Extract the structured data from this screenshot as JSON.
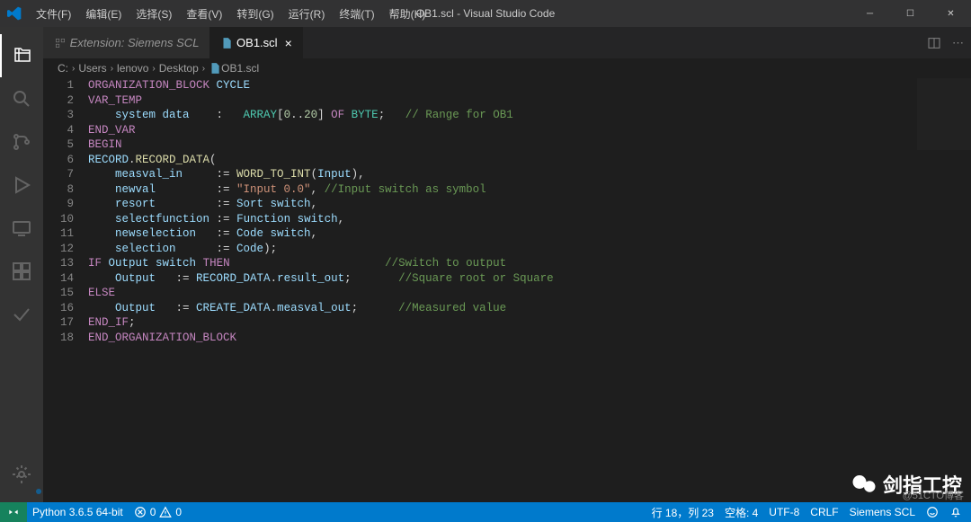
{
  "window": {
    "title": "OB1.scl - Visual Studio Code"
  },
  "menu": {
    "file": "文件(F)",
    "edit": "编辑(E)",
    "select": "选择(S)",
    "view": "查看(V)",
    "go": "转到(G)",
    "run": "运行(R)",
    "terminal": "终端(T)",
    "help": "帮助(H)"
  },
  "tabs": {
    "ext": "Extension: Siemens SCL",
    "file": "OB1.scl"
  },
  "breadcrumb": {
    "seg0": "C:",
    "seg1": "Users",
    "seg2": "lenovo",
    "seg3": "Desktop",
    "seg4": "OB1.scl"
  },
  "lines": [
    [
      {
        "t": "k",
        "v": "ORGANIZATION_BLOCK"
      },
      {
        "t": "p",
        "v": " "
      },
      {
        "t": "id",
        "v": "CYCLE"
      }
    ],
    [
      {
        "t": "k",
        "v": "VAR_TEMP"
      }
    ],
    [
      {
        "t": "p",
        "v": "    "
      },
      {
        "t": "id",
        "v": "system data"
      },
      {
        "t": "p",
        "v": "    :   "
      },
      {
        "t": "ty",
        "v": "ARRAY"
      },
      {
        "t": "p",
        "v": "["
      },
      {
        "t": "n",
        "v": "0"
      },
      {
        "t": "p",
        "v": ".."
      },
      {
        "t": "n",
        "v": "20"
      },
      {
        "t": "p",
        "v": "] "
      },
      {
        "t": "k",
        "v": "OF"
      },
      {
        "t": "p",
        "v": " "
      },
      {
        "t": "ty",
        "v": "BYTE"
      },
      {
        "t": "p",
        "v": ";   "
      },
      {
        "t": "c",
        "v": "// Range for OB1"
      }
    ],
    [
      {
        "t": "k",
        "v": "END_VAR"
      }
    ],
    [
      {
        "t": "k",
        "v": "BEGIN"
      }
    ],
    [
      {
        "t": "id",
        "v": "RECORD"
      },
      {
        "t": "p",
        "v": "."
      },
      {
        "t": "fn",
        "v": "RECORD_DATA"
      },
      {
        "t": "p",
        "v": "("
      }
    ],
    [
      {
        "t": "p",
        "v": "    "
      },
      {
        "t": "id",
        "v": "measval_in"
      },
      {
        "t": "p",
        "v": "     := "
      },
      {
        "t": "fn",
        "v": "WORD_TO_INT"
      },
      {
        "t": "p",
        "v": "("
      },
      {
        "t": "id",
        "v": "Input"
      },
      {
        "t": "p",
        "v": "),"
      }
    ],
    [
      {
        "t": "p",
        "v": "    "
      },
      {
        "t": "id",
        "v": "newval"
      },
      {
        "t": "p",
        "v": "         := "
      },
      {
        "t": "s",
        "v": "\"Input 0.0\""
      },
      {
        "t": "p",
        "v": ", "
      },
      {
        "t": "c",
        "v": "//Input switch as symbol"
      }
    ],
    [
      {
        "t": "p",
        "v": "    "
      },
      {
        "t": "id",
        "v": "resort"
      },
      {
        "t": "p",
        "v": "         := "
      },
      {
        "t": "id",
        "v": "Sort switch"
      },
      {
        "t": "p",
        "v": ","
      }
    ],
    [
      {
        "t": "p",
        "v": "    "
      },
      {
        "t": "id",
        "v": "selectfunction"
      },
      {
        "t": "p",
        "v": " := "
      },
      {
        "t": "id",
        "v": "Function switch"
      },
      {
        "t": "p",
        "v": ","
      }
    ],
    [
      {
        "t": "p",
        "v": "    "
      },
      {
        "t": "id",
        "v": "newselection"
      },
      {
        "t": "p",
        "v": "   := "
      },
      {
        "t": "id",
        "v": "Code switch"
      },
      {
        "t": "p",
        "v": ","
      }
    ],
    [
      {
        "t": "p",
        "v": "    "
      },
      {
        "t": "id",
        "v": "selection"
      },
      {
        "t": "p",
        "v": "      := "
      },
      {
        "t": "id",
        "v": "Code"
      },
      {
        "t": "p",
        "v": ");"
      }
    ],
    [
      {
        "t": "k",
        "v": "IF"
      },
      {
        "t": "p",
        "v": " "
      },
      {
        "t": "id",
        "v": "Output switch"
      },
      {
        "t": "p",
        "v": " "
      },
      {
        "t": "k",
        "v": "THEN"
      },
      {
        "t": "p",
        "v": "                       "
      },
      {
        "t": "c",
        "v": "//Switch to output"
      }
    ],
    [
      {
        "t": "p",
        "v": "    "
      },
      {
        "t": "id",
        "v": "Output"
      },
      {
        "t": "p",
        "v": "   := "
      },
      {
        "t": "id",
        "v": "RECORD_DATA"
      },
      {
        "t": "p",
        "v": "."
      },
      {
        "t": "id",
        "v": "result_out"
      },
      {
        "t": "p",
        "v": ";       "
      },
      {
        "t": "c",
        "v": "//Square root or Square"
      }
    ],
    [
      {
        "t": "k",
        "v": "ELSE"
      }
    ],
    [
      {
        "t": "p",
        "v": "    "
      },
      {
        "t": "id",
        "v": "Output"
      },
      {
        "t": "p",
        "v": "   := "
      },
      {
        "t": "id",
        "v": "CREATE_DATA"
      },
      {
        "t": "p",
        "v": "."
      },
      {
        "t": "id",
        "v": "measval_out"
      },
      {
        "t": "p",
        "v": ";      "
      },
      {
        "t": "c",
        "v": "//Measured value"
      }
    ],
    [
      {
        "t": "k",
        "v": "END_IF"
      },
      {
        "t": "p",
        "v": ";"
      }
    ],
    [
      {
        "t": "k",
        "v": "END_ORGANIZATION_BLOCK"
      }
    ]
  ],
  "status": {
    "python": "Python 3.6.5 64-bit",
    "errors": "0",
    "warnings": "0",
    "lncol": "行 18，列 23",
    "spaces": "空格: 4",
    "encoding": "UTF-8",
    "eol": "CRLF",
    "lang": "Siemens SCL"
  },
  "watermark": "剑指工控",
  "watermark_sub": "@51CTO博客"
}
